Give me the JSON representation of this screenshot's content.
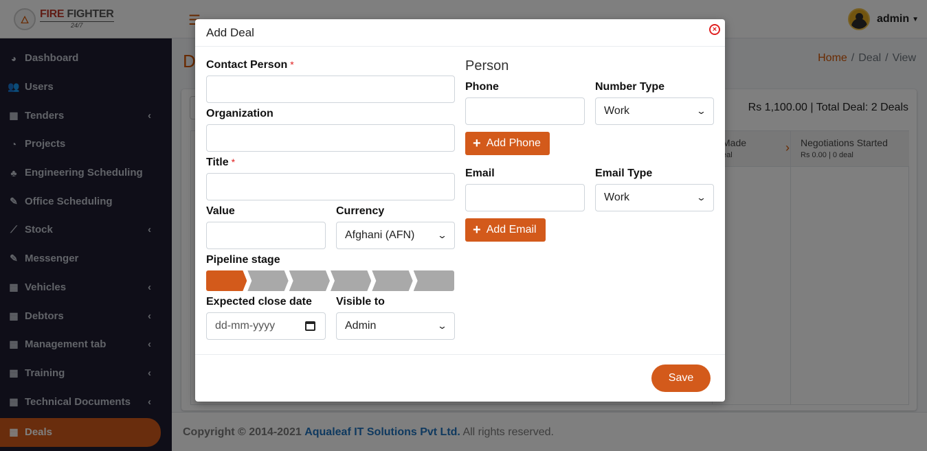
{
  "brand": {
    "line1a": "FIRE",
    "line1b": "FIGHTER",
    "line2": "24/7"
  },
  "sidebar": {
    "items": [
      {
        "label": "Dashboard",
        "icon": "tachometer-icon",
        "glyph": "◕",
        "has_children": false
      },
      {
        "label": "Users",
        "icon": "users-icon",
        "glyph": "👥",
        "has_children": false
      },
      {
        "label": "Tenders",
        "icon": "grid-icon",
        "glyph": "▦",
        "has_children": true
      },
      {
        "label": "Projects",
        "icon": "pie-chart-icon",
        "glyph": "◔",
        "has_children": false
      },
      {
        "label": "Engineering Scheduling",
        "icon": "tree-icon",
        "glyph": "♣",
        "has_children": false
      },
      {
        "label": "Office Scheduling",
        "icon": "edit-icon",
        "glyph": "✎",
        "has_children": false
      },
      {
        "label": "Stock",
        "icon": "line-chart-icon",
        "glyph": "⟋",
        "has_children": true
      },
      {
        "label": "Messenger",
        "icon": "edit-icon",
        "glyph": "✎",
        "has_children": false
      },
      {
        "label": "Vehicles",
        "icon": "grid-icon",
        "glyph": "▦",
        "has_children": true
      },
      {
        "label": "Debtors",
        "icon": "grid-icon",
        "glyph": "▦",
        "has_children": true
      },
      {
        "label": "Management tab",
        "icon": "grid-icon",
        "glyph": "▦",
        "has_children": true
      },
      {
        "label": "Training",
        "icon": "grid-icon",
        "glyph": "▦",
        "has_children": true
      },
      {
        "label": "Technical Documents",
        "icon": "grid-icon",
        "glyph": "▦",
        "has_children": true
      },
      {
        "label": "Deals",
        "icon": "grid-icon",
        "glyph": "▦",
        "has_children": false,
        "active": true
      }
    ]
  },
  "header": {
    "user_name": "admin"
  },
  "page": {
    "title_initial": "D",
    "breadcrumb": {
      "home": "Home",
      "section": "Deal",
      "current": "View"
    },
    "summary": "Rs 1,100.00 | Total Deal: 2 Deals",
    "stages": [
      {
        "name": "Made",
        "sub": "eal"
      },
      {
        "name": "Negotiations Started",
        "sub": "Rs 0.00 | 0 deal"
      }
    ]
  },
  "footer": {
    "prefix": "Copyright © 2014-2021",
    "company": "Aqualeaf IT Solutions Pvt Ltd.",
    "suffix": "All rights reserved."
  },
  "modal": {
    "title": "Add Deal",
    "fields": {
      "contact_person": {
        "label": "Contact Person",
        "required_mark": "*",
        "value": ""
      },
      "organization": {
        "label": "Organization",
        "value": ""
      },
      "title": {
        "label": "Title",
        "required_mark": "*",
        "value": ""
      },
      "value": {
        "label": "Value",
        "value": ""
      },
      "currency": {
        "label": "Currency",
        "selected": "Afghani (AFN)"
      },
      "pipeline_stage": {
        "label": "Pipeline stage",
        "segments": 6,
        "active_index": 0
      },
      "expected_close_date": {
        "label": "Expected close date",
        "placeholder": "dd-mm-yyyy"
      },
      "visible_to": {
        "label": "Visible to",
        "selected": "Admin"
      }
    },
    "person": {
      "heading": "Person",
      "phone_label": "Phone",
      "phone_value": "",
      "number_type_label": "Number Type",
      "number_type_selected": "Work",
      "add_phone_label": "Add Phone",
      "email_label": "Email",
      "email_value": "",
      "email_type_label": "Email Type",
      "email_type_selected": "Work",
      "add_email_label": "Add Email"
    },
    "save_label": "Save"
  },
  "colors": {
    "accent": "#d35a1b",
    "sidebar_bg": "#1e1c30",
    "link": "#1e73be",
    "danger": "#e02020"
  }
}
